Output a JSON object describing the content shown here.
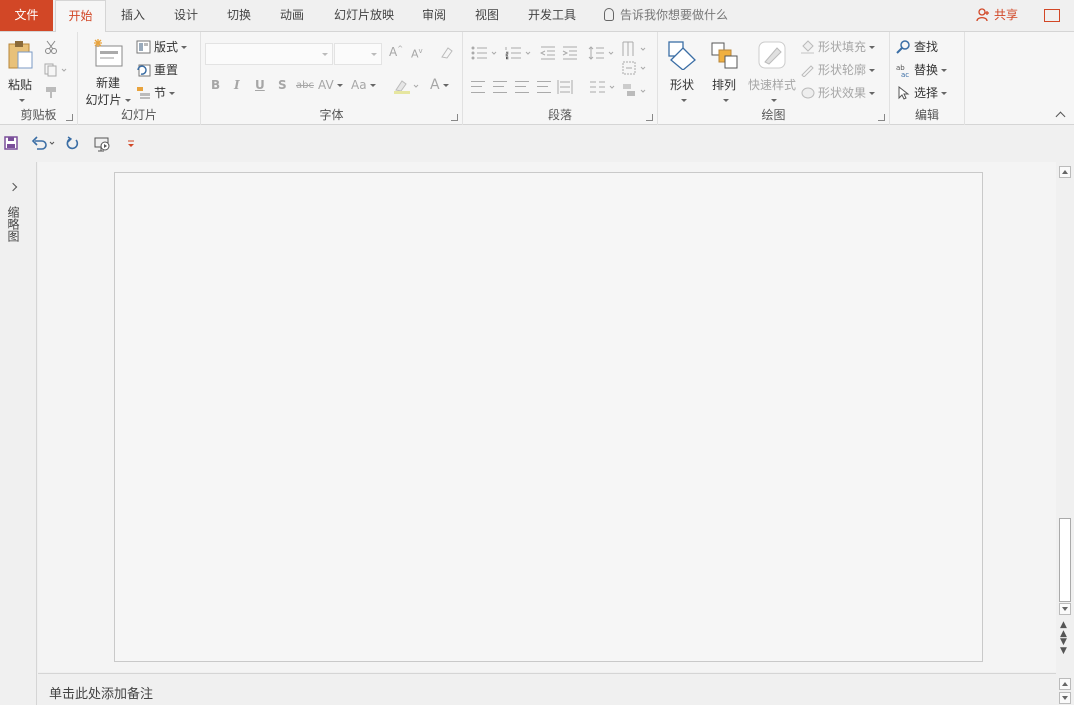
{
  "tabs": {
    "file": "文件",
    "home": "开始",
    "insert": "插入",
    "design": "设计",
    "transitions": "切换",
    "animations": "动画",
    "slideshow": "幻灯片放映",
    "review": "审阅",
    "view": "视图",
    "developer": "开发工具"
  },
  "tell_me": "告诉我你想要做什么",
  "share": "共享",
  "ribbon": {
    "clipboard": {
      "label": "剪贴板",
      "paste": "粘贴"
    },
    "slides": {
      "label": "幻灯片",
      "new_slide_1": "新建",
      "new_slide_2": "幻灯片",
      "layout": "版式",
      "reset": "重置",
      "section": "节"
    },
    "font": {
      "label": "字体",
      "bold": "B",
      "italic": "I",
      "underline": "U",
      "strike": "S",
      "abc": "abc",
      "spacing": "AV",
      "case": "Aa",
      "color": "A"
    },
    "paragraph": {
      "label": "段落"
    },
    "drawing": {
      "label": "绘图",
      "shapes": "形状",
      "arrange": "排列",
      "quick_styles": "快速样式",
      "fill": "形状填充",
      "outline": "形状轮廓",
      "effects": "形状效果"
    },
    "editing": {
      "label": "编辑",
      "find": "查找",
      "replace": "替换",
      "select": "选择"
    }
  },
  "thumbnail_pane": "缩略图",
  "notes_placeholder": "单击此处添加备注",
  "colors": {
    "accent": "#d24726",
    "qat_save": "#7a4f9a",
    "qat_undo": "#3b6ea5"
  }
}
